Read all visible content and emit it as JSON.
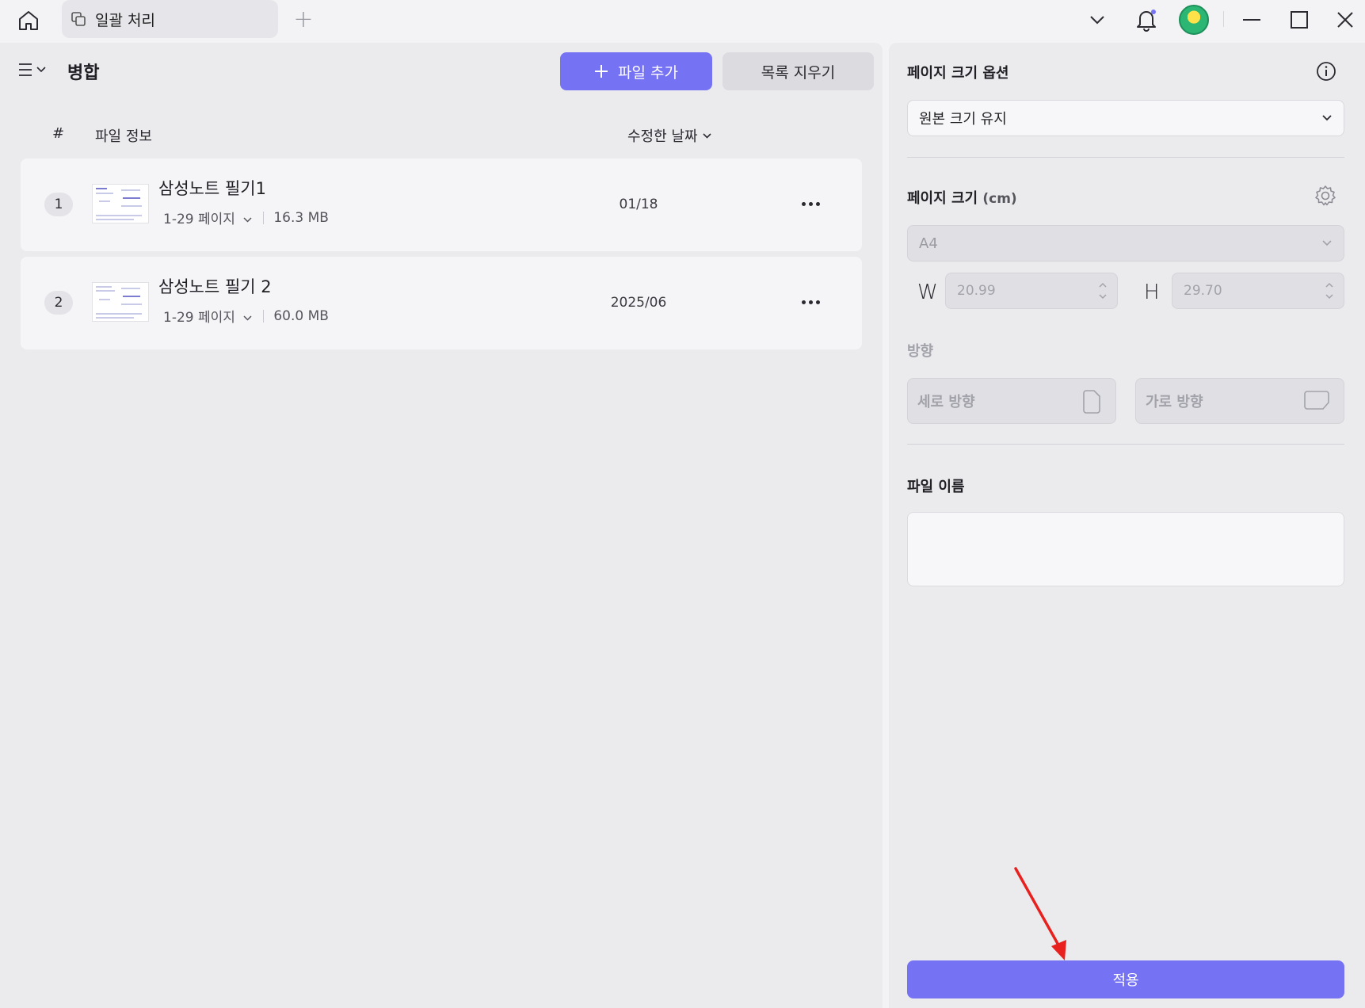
{
  "titlebar": {
    "tab_label": "일괄 처리",
    "icons": [
      "home-icon",
      "copy-icon",
      "plus-icon",
      "chevron-down-icon",
      "bell-icon",
      "avatar",
      "minimize-icon",
      "maximize-icon",
      "close-icon"
    ]
  },
  "left": {
    "title": "병합",
    "add_button": "파일 추가",
    "clear_button": "목록 지우기",
    "columns": {
      "num": "#",
      "info": "파일 정보",
      "date": "수정한 날짜"
    },
    "files": [
      {
        "num": "1",
        "name": "삼성노트 필기1",
        "pages": "1-29 페이지",
        "size": "16.3 MB",
        "date": "01/18"
      },
      {
        "num": "2",
        "name": "삼성노트 필기 2",
        "pages": "1-29 페이지",
        "size": "60.0 MB",
        "date": "2025/06"
      }
    ]
  },
  "right": {
    "page_size_options_title": "페이지 크기 옵션",
    "page_size_option_value": "원본 크기 유지",
    "page_size_title": "페이지 크기",
    "page_size_unit": "(cm)",
    "paper_value": "A4",
    "w_label": "W",
    "w_value": "20.99",
    "h_label": "H",
    "h_value": "29.70",
    "orientation_title": "방향",
    "portrait": "세로 방향",
    "landscape": "가로 방향",
    "file_name_title": "파일 이름",
    "file_name_value": "",
    "apply_button": "적용"
  },
  "colors": {
    "accent": "#7672f4",
    "annotation_arrow": "#e8201e"
  }
}
